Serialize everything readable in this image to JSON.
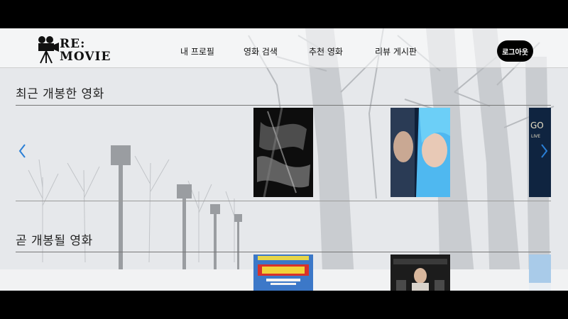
{
  "brand": {
    "logo_line1": "RE:",
    "logo_line2": "MOVIE"
  },
  "nav": [
    {
      "label": "내 프로필"
    },
    {
      "label": "영화 검색"
    },
    {
      "label": "추천 영화"
    },
    {
      "label": "리뷰 게시판"
    }
  ],
  "header": {
    "logout_label": "로그아웃"
  },
  "sections": {
    "now_showing": {
      "title": "최근 개봉한 영화"
    },
    "upcoming": {
      "title": "곧 개봉될 영화"
    }
  },
  "icons": {
    "logo": "film-camera-icon",
    "prev": "chevron-left-icon",
    "next": "chevron-right-icon"
  },
  "colors": {
    "accent": "#2a7fd6",
    "button": "#000000"
  }
}
